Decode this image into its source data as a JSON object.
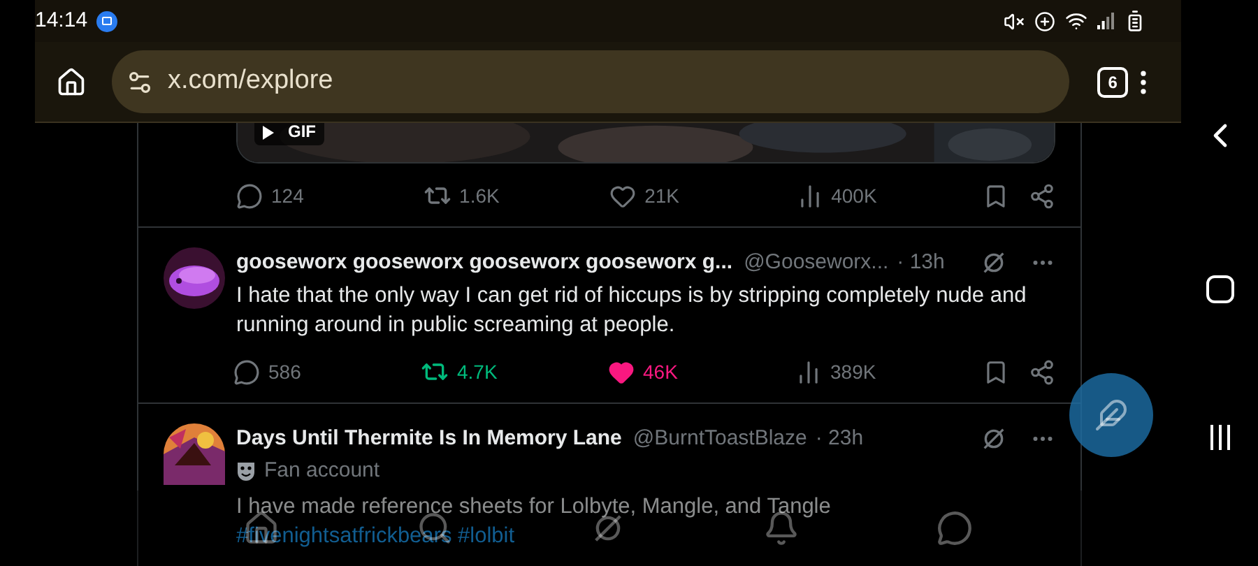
{
  "status_bar": {
    "time": "14:14"
  },
  "browser": {
    "url": "x.com/explore",
    "tab_count": "6"
  },
  "tweets": [
    {
      "kind": "partial",
      "media_label": "GIF",
      "actions": [
        {
          "kind": "reply",
          "count": "124",
          "on": false
        },
        {
          "kind": "repost",
          "count": "1.6K",
          "on": false
        },
        {
          "kind": "like",
          "count": "21K",
          "on": false
        },
        {
          "kind": "views",
          "count": "400K",
          "on": false
        }
      ]
    },
    {
      "kind": "full",
      "name": "gooseworx gooseworx gooseworx gooseworx g...",
      "handle": "@Gooseworx...",
      "time": "· 13h",
      "text": "I hate that the only way I can get rid of hiccups is by stripping completely nude and running around in public screaming at people.",
      "actions": [
        {
          "kind": "reply",
          "count": "586",
          "on": false
        },
        {
          "kind": "repost",
          "count": "4.7K",
          "on": true
        },
        {
          "kind": "like",
          "count": "46K",
          "on": true
        },
        {
          "kind": "views",
          "count": "389K",
          "on": false
        }
      ]
    },
    {
      "kind": "full",
      "name": "Days Until Thermite Is In Memory Lane",
      "handle": "@BurntToastBlaze",
      "time": "· 23h",
      "label": "Fan account",
      "text": "I have made reference sheets for Lolbyte, Mangle, and Tangle",
      "hashtags": "#fivenightsatfrickbears #lolbit"
    }
  ],
  "bottom_nav": [
    {
      "kind": "home"
    },
    {
      "kind": "search"
    },
    {
      "kind": "grok"
    },
    {
      "kind": "notifications"
    },
    {
      "kind": "messages"
    }
  ]
}
